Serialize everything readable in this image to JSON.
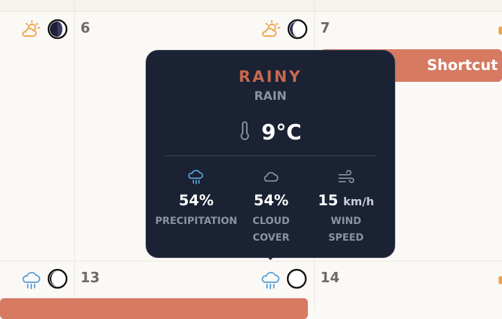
{
  "calendar": {
    "days": [
      {
        "number": "6"
      },
      {
        "number": "7"
      },
      {
        "number": "13"
      },
      {
        "number": "14"
      }
    ],
    "events": [
      {
        "title": "Shortcut"
      }
    ]
  },
  "tooltip": {
    "condition": "RAINY",
    "subtitle": "RAIN",
    "temperature": "9°C",
    "stats": [
      {
        "icon": "rain-cloud-icon",
        "value": "54%",
        "unit": "",
        "label": "PRECIPITATION"
      },
      {
        "icon": "cloud-icon",
        "value": "54%",
        "unit": "",
        "label": "CLOUD COVER"
      },
      {
        "icon": "wind-icon",
        "value": "15",
        "unit": "km/h",
        "label": "WIND SPEED"
      }
    ]
  },
  "colors": {
    "event": "#d67a62",
    "sun": "#f0a64a",
    "rain": "#5aa3dc",
    "tooltip_bg": "#1b2233",
    "condition": "#c9694f"
  }
}
